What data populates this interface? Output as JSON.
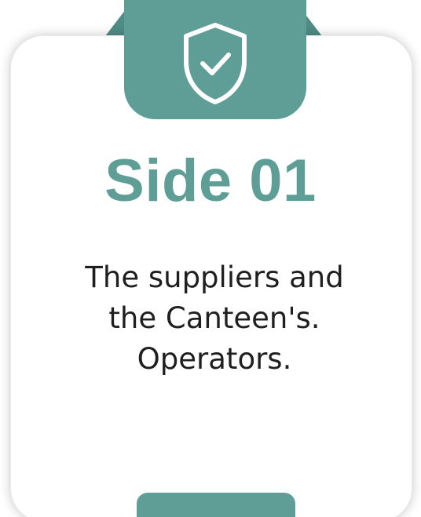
{
  "colors": {
    "accent": "#5f9e97",
    "accent_dark": "#4f8c85",
    "text": "#1f1f1f",
    "card": "#ffffff"
  },
  "badge": {
    "icon": "shield-check-icon"
  },
  "card": {
    "title": "Side 01",
    "description_lines": [
      "The suppliers and",
      "the Canteen's.",
      "Operators."
    ]
  }
}
